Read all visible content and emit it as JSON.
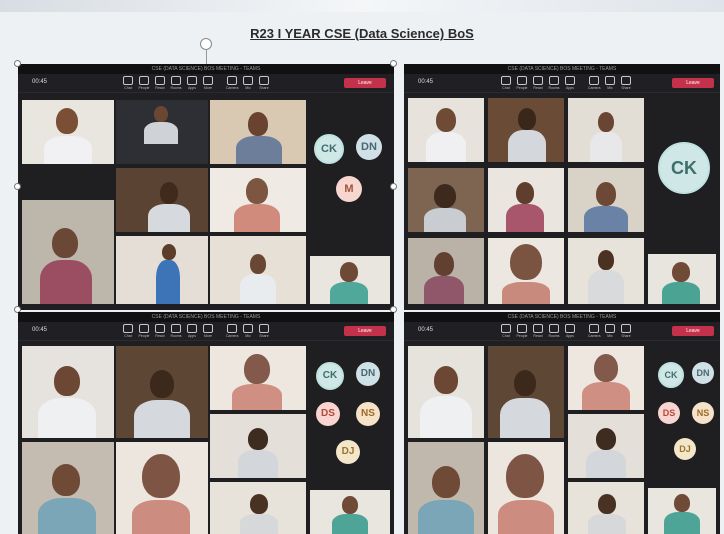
{
  "slide": {
    "title": "R23 I YEAR CSE (Data Science) BoS"
  },
  "window_title": "CSE (DATA SCIENCE) BOS MEETING - TEAMS",
  "meeting": {
    "timer": "00:45",
    "leave_label": "Leave"
  },
  "toolbar_items": [
    "Chat",
    "People",
    "React",
    "Rooms",
    "Apps",
    "More",
    "Camera",
    "Mic",
    "Share"
  ],
  "avatars": {
    "ck": "CK",
    "dn": "DN",
    "m": "M",
    "ds": "DS",
    "ns": "NS",
    "dj": "DJ"
  },
  "colors": {
    "teams_dark": "#1f1f22",
    "leave_red": "#c4314b",
    "avatar_ck": "#cfe7e6"
  }
}
